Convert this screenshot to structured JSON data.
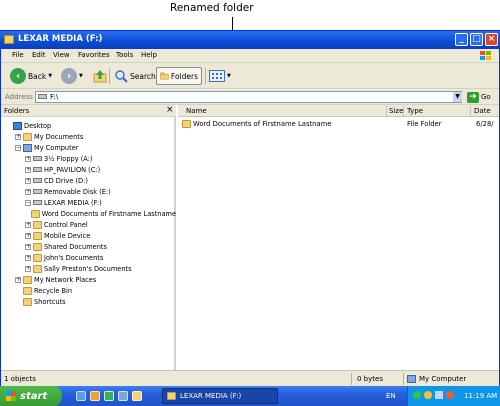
{
  "annotation": {
    "callout": "Renamed folder"
  },
  "window": {
    "title": "LEXAR MEDIA (F:)"
  },
  "menu": [
    "File",
    "Edit",
    "View",
    "Favorites",
    "Tools",
    "Help"
  ],
  "toolbar": {
    "back": "Back",
    "search": "Search",
    "folders": "Folders"
  },
  "address": {
    "label": "Address",
    "value": "F:\\",
    "go": "Go"
  },
  "folders_pane": {
    "title": "Folders",
    "close": "×",
    "tree": [
      {
        "label": "Desktop",
        "icon": "desktop-icon",
        "indent": 0,
        "expander": ""
      },
      {
        "label": "My Documents",
        "icon": "folder-icon",
        "indent": 1,
        "expander": "+"
      },
      {
        "label": "My Computer",
        "icon": "computer-icon",
        "indent": 1,
        "expander": "−"
      },
      {
        "label": "3½ Floppy (A:)",
        "icon": "floppy-icon",
        "indent": 2,
        "expander": "+"
      },
      {
        "label": "HP_PAVILION (C:)",
        "icon": "drive-icon",
        "indent": 2,
        "expander": "+"
      },
      {
        "label": "CD Drive (D:)",
        "icon": "cd-icon",
        "indent": 2,
        "expander": "+"
      },
      {
        "label": "Removable Disk (E:)",
        "icon": "drive-icon",
        "indent": 2,
        "expander": "+"
      },
      {
        "label": "LEXAR MEDIA (F:)",
        "icon": "drive-icon",
        "indent": 2,
        "expander": "−"
      },
      {
        "label": "Word Documents of Firstname Lastname",
        "icon": "folder-icon",
        "indent": 3,
        "expander": ""
      },
      {
        "label": "Control Panel",
        "icon": "control-panel-icon",
        "indent": 2,
        "expander": "+"
      },
      {
        "label": "Mobile Device",
        "icon": "mobile-icon",
        "indent": 2,
        "expander": "+"
      },
      {
        "label": "Shared Documents",
        "icon": "folder-icon",
        "indent": 2,
        "expander": "+"
      },
      {
        "label": "John's Documents",
        "icon": "folder-icon",
        "indent": 2,
        "expander": "+"
      },
      {
        "label": "Sally Preston's Documents",
        "icon": "folder-icon",
        "indent": 2,
        "expander": "+"
      },
      {
        "label": "My Network Places",
        "icon": "network-icon",
        "indent": 1,
        "expander": "+"
      },
      {
        "label": "Recycle Bin",
        "icon": "recycle-bin-icon",
        "indent": 1,
        "expander": ""
      },
      {
        "label": "Shortcuts",
        "icon": "folder-icon",
        "indent": 1,
        "expander": ""
      }
    ]
  },
  "file_list": {
    "columns": [
      "Name",
      "Size",
      "Type",
      "Date"
    ],
    "rows": [
      {
        "name": "Word Documents of Firstname Lastname",
        "size": "",
        "type": "File Folder",
        "date": "6/28/"
      }
    ]
  },
  "status": {
    "objects": "1 objects",
    "size": "0 bytes",
    "location": "My Computer"
  },
  "taskbar": {
    "start": "start",
    "task": "LEXAR MEDIA (F:)",
    "lang": "EN",
    "time": "11:19 AM"
  }
}
